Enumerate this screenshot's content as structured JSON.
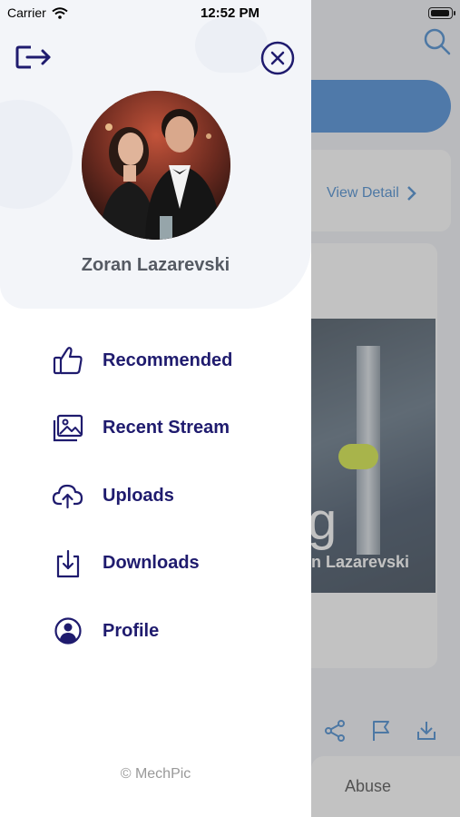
{
  "status_bar": {
    "carrier": "Carrier",
    "time": "12:52 PM"
  },
  "drawer": {
    "user_name": "Zoran Lazarevski",
    "menu": [
      {
        "label": "Recommended",
        "icon": "thumbs-up-icon"
      },
      {
        "label": "Recent Stream",
        "icon": "gallery-icon"
      },
      {
        "label": "Uploads",
        "icon": "cloud-upload-icon"
      },
      {
        "label": "Downloads",
        "icon": "download-icon"
      },
      {
        "label": "Profile",
        "icon": "user-circle-icon"
      }
    ],
    "copyright": "© MechPic"
  },
  "background": {
    "view_detail": "View Detail",
    "video_caption": "n Lazarevski",
    "video_letter": "g",
    "abuse_label": "Abuse"
  },
  "colors": {
    "menu_text": "#1f1b6e",
    "accent_blue": "#2f7ad1",
    "name_text": "#555a63"
  }
}
